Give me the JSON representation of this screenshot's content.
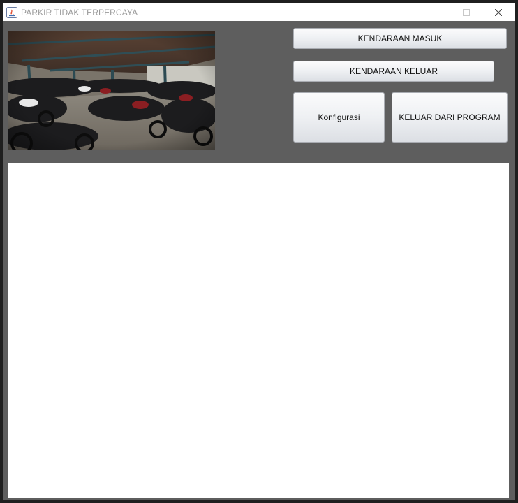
{
  "window": {
    "title": "PARKIR TIDAK TERPERCAYA",
    "controls": {
      "minimize": "—",
      "maximize": "☐",
      "close": "✕"
    }
  },
  "buttons": {
    "vehicle_in": "KENDARAAN MASUK",
    "vehicle_out": "KENDARAAN KELUAR",
    "configuration": "Konfigurasi",
    "exit_program": "KELUAR DARI PROGRAM"
  },
  "image": {
    "subject": "motorcycle-parking-lot-photo"
  },
  "colors": {
    "window_background": "#5e5e5e",
    "panel_background": "#ffffff",
    "title_text": "#9a9a9a"
  }
}
